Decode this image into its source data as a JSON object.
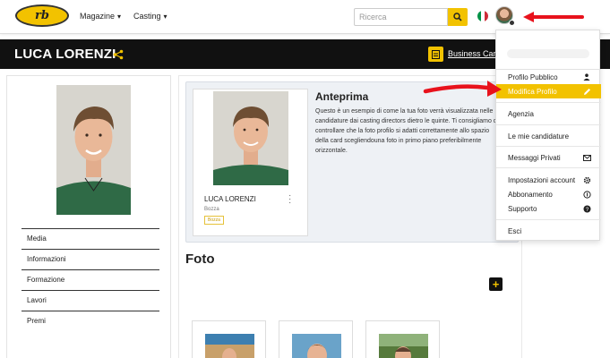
{
  "nav": {
    "logo_text": "rb",
    "links": [
      {
        "label": "Magazine"
      },
      {
        "label": "Casting"
      }
    ],
    "search_placeholder": "Ricerca",
    "flag_colors": [
      "#009246",
      "#ffffff",
      "#ce2b37"
    ]
  },
  "profile": {
    "name": "LUCA LORENZI",
    "business_card_label": "Business Card"
  },
  "sidebar": {
    "items": [
      {
        "label": "Media"
      },
      {
        "label": "Informazioni"
      },
      {
        "label": "Formazione"
      },
      {
        "label": "Lavori"
      },
      {
        "label": "Premi"
      }
    ]
  },
  "preview": {
    "title": "Anteprima",
    "text": "Questo è un esempio di come la tua foto verrà visualizzata nelle candidature dai casting directors dietro le quinte. Ti consigliamo di controllare che la foto profilo si adatti correttamente allo spazio della card scegliendouna foto in primo piano preferibilmente orizzontale.",
    "card_name": "LUCA LORENZI",
    "card_status": "Bozza",
    "card_badge": "Bozza"
  },
  "foto": {
    "title": "Foto",
    "add_label": "+"
  },
  "dropdown": {
    "items": [
      {
        "label": "Profilo Pubblico",
        "icon": "person-icon"
      },
      {
        "label": "Modifica Profilo",
        "icon": "pencil-icon",
        "active": true
      },
      {
        "label": "Agenzia",
        "icon": ""
      },
      {
        "label": "Le mie candidature",
        "icon": ""
      },
      {
        "label": "Messaggi Privati",
        "icon": "mail-icon"
      },
      {
        "label": "Impostazioni account",
        "icon": "gear-icon"
      },
      {
        "label": "Abbonamento",
        "icon": "coin-icon"
      },
      {
        "label": "Supporto",
        "icon": "help-icon"
      },
      {
        "label": "Esci",
        "icon": ""
      }
    ]
  },
  "colors": {
    "accent": "#f2c200",
    "annotation_red": "#e8121c",
    "bar": "#111111"
  }
}
